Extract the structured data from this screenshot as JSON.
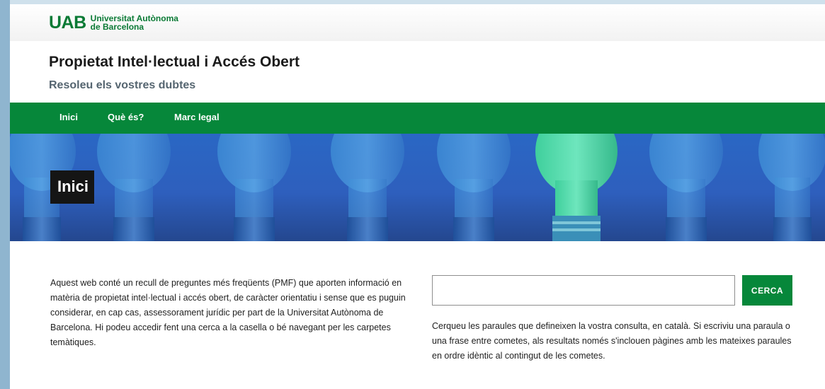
{
  "logo": {
    "mark": "UAB",
    "line1": "Universitat Autònoma",
    "line2": "de Barcelona"
  },
  "header": {
    "title": "Propietat Intel·lectual i Accés Obert",
    "subtitle": "Resoleu els vostres dubtes"
  },
  "nav": {
    "items": [
      "Inici",
      "Què és?",
      "Marc legal"
    ]
  },
  "hero": {
    "title": "Inici"
  },
  "intro": {
    "text": "Aquest web conté un recull de preguntes més freqüents (PMF) que aporten informació en matèria de propietat intel·lectual i accés obert, de caràcter orientatiu i sense que es puguin considerar, en cap cas, assessorament jurídic per part de la Universitat Autònoma de Barcelona. Hi podeu accedir fent una cerca a la casella o bé navegant per les carpetes temàtiques."
  },
  "search": {
    "value": "",
    "placeholder": "",
    "button_label": "CERCA",
    "help_text": "Cerqueu les paraules que defineixen la vostra consulta, en català. Si escriviu una paraula o una frase entre cometes, als resultats només s'inclouen pàgines amb les mateixes paraules en ordre idèntic al contingut de les cometes."
  },
  "colors": {
    "brand_green": "#06873a",
    "hero_blue": "#2e5fbd",
    "highlight_bulb": "#4fd6a6"
  }
}
